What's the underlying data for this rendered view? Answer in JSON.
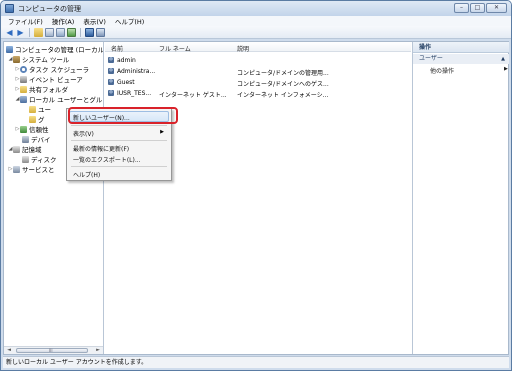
{
  "window": {
    "title": "コンピュータの管理",
    "btn_min": "–",
    "btn_max": "□",
    "btn_close": "✕"
  },
  "menubar": {
    "items": [
      "ファイル(F)",
      "操作(A)",
      "表示(V)",
      "ヘルプ(H)"
    ]
  },
  "toolbar": {
    "icons": [
      "back-arrow-icon",
      "forward-arrow-icon",
      "up-folder-icon",
      "show-hide-tree-icon",
      "export-icon",
      "refresh-icon",
      "help-icon",
      "properties-icon"
    ]
  },
  "tree": {
    "root": "コンピュータの管理 (ローカル)",
    "system_tools": "システム ツール",
    "task_scheduler": "タスク スケジューラ",
    "event_viewer": "イベント ビューア",
    "shared_folders": "共有フォルダ",
    "local_users": "ローカル ユーザーとグル",
    "users_folder": "ユー",
    "groups_folder": "グ",
    "reliability": "信頼性",
    "device_manager": "デバイ",
    "storage": "記憶域",
    "disk_management": "ディスク",
    "services": "サービスと"
  },
  "scrollbar": {
    "left_arrow": "◄",
    "right_arrow": "►",
    "grip": "III"
  },
  "list": {
    "headers": {
      "name": "名前",
      "full_name": "フル ネーム",
      "description": "説明"
    },
    "rows": [
      {
        "name": "admin",
        "full_name": "",
        "description": ""
      },
      {
        "name": "Administra...",
        "full_name": "",
        "description": "コンピュータ/ドメインの管理用..."
      },
      {
        "name": "Guest",
        "full_name": "",
        "description": "コンピュータ/ドメインへのゲス..."
      },
      {
        "name": "IUSR_TES...",
        "full_name": "インターネット ゲスト...",
        "description": "インターネット インフォメーシ..."
      }
    ]
  },
  "actions": {
    "title": "操作",
    "section": "ユーザー",
    "item": "他の操作"
  },
  "context_menu": {
    "new_user": "新しいユーザー(N)...",
    "view": "表示(V)",
    "refresh": "最新の情報に更新(F)",
    "export_list": "一覧のエクスポート(L)...",
    "help": "ヘルプ(H)",
    "submenu_arrow": "▶"
  },
  "statusbar": {
    "text": "新しいローカル ユーザー アカウントを作成します。"
  }
}
